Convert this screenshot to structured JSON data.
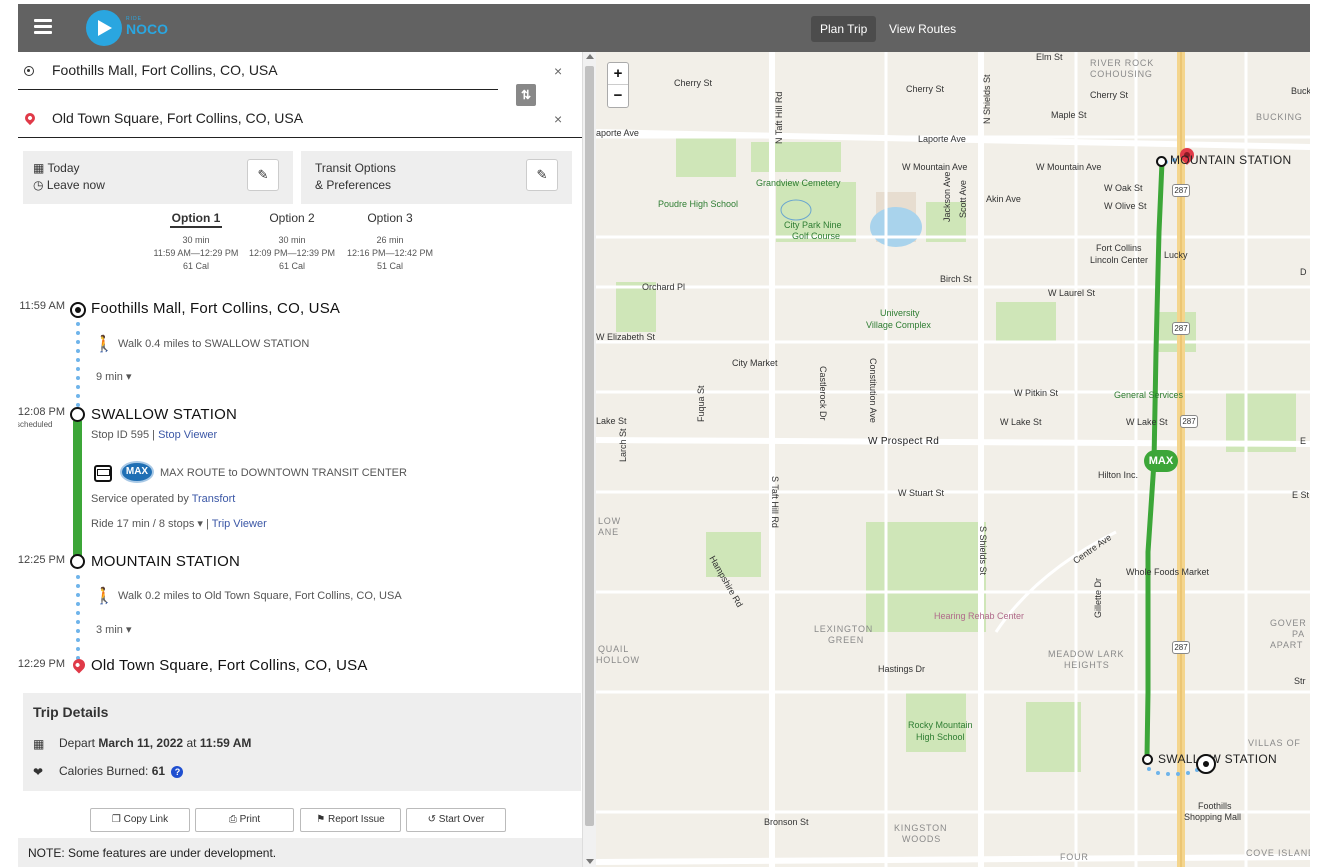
{
  "header": {
    "logo_small": "RIDE",
    "logo_big": "NOCO",
    "nav": [
      "Plan Trip",
      "View Routes"
    ]
  },
  "trip_form": {
    "origin": "Foothills Mall, Fort Collins, CO, USA",
    "destination": "Old Town Square, Fort Collins, CO, USA",
    "when_line1": "Today",
    "when_line2": "Leave now",
    "prefs_line1": "Transit Options",
    "prefs_line2": "& Preferences",
    "clear_glyph": "×",
    "swap_glyph": "⇅",
    "edit_glyph": "✎"
  },
  "options": [
    {
      "label": "Option 1",
      "duration": "30 min",
      "times": "11:59 AM—12:29 PM",
      "calories": "61 Cal",
      "active": true
    },
    {
      "label": "Option 2",
      "duration": "30 min",
      "times": "12:09 PM—12:39 PM",
      "calories": "61 Cal",
      "active": false
    },
    {
      "label": "Option 3",
      "duration": "26 min",
      "times": "12:16 PM—12:42 PM",
      "calories": "51 Cal",
      "active": false
    }
  ],
  "itinerary": {
    "start_time": "11:59 AM",
    "start_place": "Foothills Mall, Fort Collins, CO, USA",
    "walk1_text": "Walk 0.4 miles to SWALLOW STATION",
    "walk1_duration": "9 min",
    "board_time": "12:08 PM",
    "board_scheduled": "scheduled",
    "board_stop": "SWALLOW STATION",
    "board_stop_id": "Stop ID 595 |",
    "stop_viewer_link": "Stop Viewer",
    "route_badge": "MAX",
    "route_name": "MAX ROUTE",
    "route_to": "to",
    "route_dest": "DOWNTOWN TRANSIT CENTER",
    "operator_prefix": "Service operated by",
    "operator": "Transfort",
    "ride_text": "Ride 17 min / 8 stops",
    "trip_viewer_sep": "|",
    "trip_viewer_link": "Trip Viewer",
    "alight_time": "12:25 PM",
    "alight_stop": "MOUNTAIN STATION",
    "walk2_text": "Walk 0.2 miles to Old Town Square, Fort Collins, CO, USA",
    "walk2_duration": "3 min",
    "end_time": "12:29 PM",
    "end_place": "Old Town Square, Fort Collins, CO, USA",
    "route_color": "#3ca638",
    "walk_color": "#6fb4ea"
  },
  "trip_details": {
    "title": "Trip Details",
    "depart_prefix": "Depart",
    "depart_date": "March 11, 2022",
    "depart_at": "at",
    "depart_time": "11:59 AM",
    "calories_label": "Calories Burned:",
    "calories_value": "61",
    "help_glyph": "?"
  },
  "actions": [
    "Copy Link",
    "Print",
    "Report Issue",
    "Start Over"
  ],
  "note": "NOTE: Some features are under development.",
  "map": {
    "zoom_in": "+",
    "zoom_out": "−",
    "route_badge": "MAX",
    "hwy": "287",
    "labels": {
      "mountain_station": "MOUNTAIN STATION",
      "swallow_station": "SWALLOW STATION",
      "elm": "Elm St",
      "river_rock": "RIVER ROCK",
      "cohousing": "COHOUSING",
      "cherry1": "Cherry St",
      "cherry2": "Cherry St",
      "cherry3": "Cherry St",
      "buck": "Buck",
      "bucking": "BUCKING",
      "maple": "Maple St",
      "laporte1": "aporte Ave",
      "laporte2": "Laporte Ave",
      "w_mountain1": "W Mountain Ave",
      "w_mountain2": "W Mountain Ave",
      "grandview": "Grandview Cemetery",
      "poudre": "Poudre High School",
      "city_park": "City Park Nine",
      "golf": "Golf Course",
      "akin": "Akin Ave",
      "w_oak": "W Oak St",
      "w_olive": "W Olive St",
      "fort_collins": "Fort Collins",
      "lincoln_center": "Lincoln Center",
      "lucky": "Lucky",
      "orchard": "Orchard Pl",
      "birch": "Birch St",
      "w_laurel": "W Laurel St",
      "university": "University",
      "village": "Village Complex",
      "w_elizabeth": "W Elizabeth St",
      "city_market": "City Market",
      "w_pitkin": "W Pitkin St",
      "general_services": "General Services",
      "lake1": "Lake St",
      "w_lake1": "W Lake St",
      "w_lake2": "W Lake St",
      "w_prospect": "W Prospect Rd",
      "hilton": "Hilton Inc.",
      "w_stuart": "W Stuart St",
      "e_st": "E St",
      "centre": "Centre Ave",
      "whole_foods": "Whole Foods Market",
      "hearing": "Hearing Rehab Center",
      "lexington": "LEXINGTON",
      "green": "GREEN",
      "meadow_lark": "MEADOW LARK",
      "heights": "HEIGHTS",
      "quail": "QUAIL",
      "hollow": "HOLLOW",
      "hastings": "Hastings Dr",
      "rocky_mountain": "Rocky Mountain",
      "high_school": "High School",
      "villas": "VILLAS OF",
      "foothills": "Foothills",
      "shopping_mall": "Shopping Mall",
      "bronson": "Bronson St",
      "kingston": "KINGSTON",
      "woods": "WOODS",
      "four": "FOUR",
      "cove_island": "COVE ISLAND",
      "low": "LOW",
      "ane": "ANE",
      "gover": "GOVER",
      "pa": "PA",
      "apart": "APART",
      "s_taft": "S Taft Hill Rd",
      "n_taft": "N Taft Hill Rd",
      "s_shields": "S Shields St",
      "n_shields": "N Shields St",
      "constitution": "Constitution Ave",
      "castlerock": "Castlerock Dr",
      "hampshire": "Hampshire Rd",
      "gillette": "Gillette Dr",
      "jackson": "Jackson Ave",
      "scott": "Scott Ave",
      "larch": "Larch St",
      "fuqua": "Fuqua St",
      "d": "D",
      "str": "Str",
      "e": "E"
    }
  }
}
